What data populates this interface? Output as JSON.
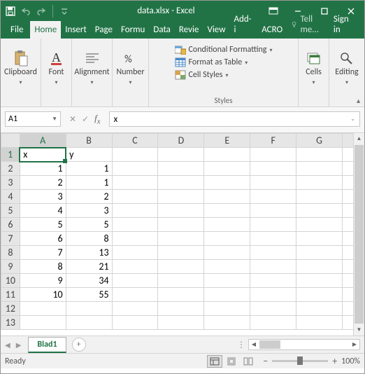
{
  "title": "data.xlsx - Excel",
  "tabs": {
    "file": "File",
    "items": [
      "Home",
      "Insert",
      "Page",
      "Formu",
      "Data",
      "Revie",
      "View",
      "Add-i",
      "ACRO"
    ]
  },
  "tellme": "Tell me...",
  "signin": "Sign in",
  "ribbon": {
    "clipboard": {
      "label": "Clipboard"
    },
    "font": {
      "label": "Font"
    },
    "alignment": {
      "label": "Alignment"
    },
    "number": {
      "label": "Number"
    },
    "styles": {
      "label": "Styles",
      "cond": "Conditional Formatting",
      "table": "Format as Table",
      "cellstyles": "Cell Styles"
    },
    "cells": {
      "label": "Cells"
    },
    "editing": {
      "label": "Editing"
    }
  },
  "namebox": "A1",
  "formula": "x",
  "colHeaders": [
    "A",
    "B",
    "C",
    "D",
    "E",
    "F",
    "G"
  ],
  "rows": [
    {
      "n": 1,
      "cells": [
        "x",
        "y",
        "",
        "",
        "",
        "",
        ""
      ]
    },
    {
      "n": 2,
      "cells": [
        "1",
        "1",
        "",
        "",
        "",
        "",
        ""
      ]
    },
    {
      "n": 3,
      "cells": [
        "2",
        "1",
        "",
        "",
        "",
        "",
        ""
      ]
    },
    {
      "n": 4,
      "cells": [
        "3",
        "2",
        "",
        "",
        "",
        "",
        ""
      ]
    },
    {
      "n": 5,
      "cells": [
        "4",
        "3",
        "",
        "",
        "",
        "",
        ""
      ]
    },
    {
      "n": 6,
      "cells": [
        "5",
        "5",
        "",
        "",
        "",
        "",
        ""
      ]
    },
    {
      "n": 7,
      "cells": [
        "6",
        "8",
        "",
        "",
        "",
        "",
        ""
      ]
    },
    {
      "n": 8,
      "cells": [
        "7",
        "13",
        "",
        "",
        "",
        "",
        ""
      ]
    },
    {
      "n": 9,
      "cells": [
        "8",
        "21",
        "",
        "",
        "",
        "",
        ""
      ]
    },
    {
      "n": 10,
      "cells": [
        "9",
        "34",
        "",
        "",
        "",
        "",
        ""
      ]
    },
    {
      "n": 11,
      "cells": [
        "10",
        "55",
        "",
        "",
        "",
        "",
        ""
      ]
    },
    {
      "n": 12,
      "cells": [
        "",
        "",
        "",
        "",
        "",
        "",
        ""
      ]
    },
    {
      "n": 13,
      "cells": [
        "",
        "",
        "",
        "",
        "",
        "",
        ""
      ]
    }
  ],
  "activeCell": {
    "row": 1,
    "col": 0
  },
  "textCells": [
    [
      1,
      0
    ],
    [
      1,
      1
    ]
  ],
  "sheet": "Blad1",
  "status": "Ready",
  "zoom": "100%"
}
